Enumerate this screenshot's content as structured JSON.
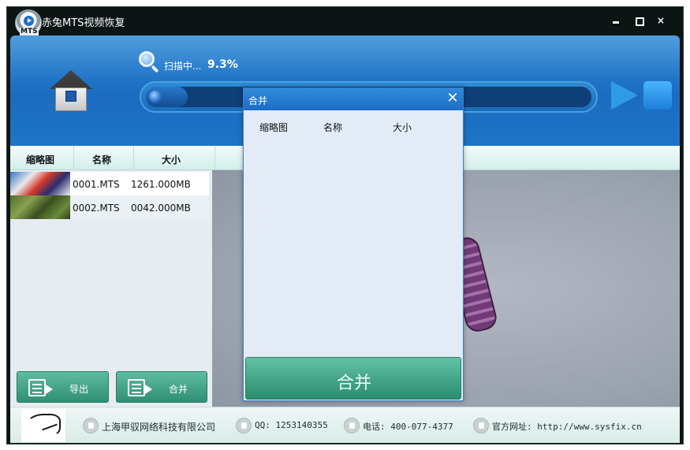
{
  "window": {
    "title": "赤兔MTS视频恢复",
    "logo_text": "MTS",
    "controls": {
      "close": "×"
    }
  },
  "header": {
    "scan_label": "扫描中...",
    "scan_percent": "9.3%",
    "progress_value": 0.093
  },
  "columns": {
    "thumbnail": "缩略图",
    "name": "名称",
    "size": "大小"
  },
  "files": [
    {
      "name": "0001.MTS",
      "size": "1261.000MB"
    },
    {
      "name": "0002.MTS",
      "size": "0042.000MB"
    }
  ],
  "buttons": {
    "export": "导出",
    "merge": "合并"
  },
  "dialog": {
    "title": "合并",
    "close": "✕",
    "columns": {
      "thumbnail": "缩略图",
      "name": "名称",
      "size": "大小"
    },
    "merge_button": "合并"
  },
  "statusbar": {
    "company": "上海甲驭网络科技有限公司",
    "qq": "QQ: 1253140355",
    "phone": "电话: 400-077-4377",
    "website": "官方网址: http://www.sysfix.cn"
  },
  "colors": {
    "accent_blue": "#1e6ec5",
    "button_green": "#2f8f73",
    "title_bar": "#0d1414"
  }
}
